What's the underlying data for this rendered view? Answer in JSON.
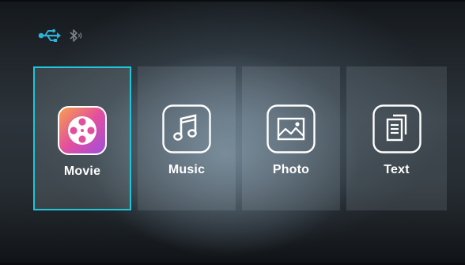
{
  "status": {
    "icons": [
      "usb-icon",
      "bluetooth-icon"
    ],
    "usb_color": "#2fb2d8"
  },
  "menu": {
    "items": [
      {
        "label": "Movie",
        "icon": "movie-icon",
        "selected": true
      },
      {
        "label": "Music",
        "icon": "music-icon",
        "selected": false
      },
      {
        "label": "Photo",
        "icon": "photo-icon",
        "selected": false
      },
      {
        "label": "Text",
        "icon": "text-icon",
        "selected": false
      }
    ]
  },
  "colors": {
    "selection": "#1ec6d8",
    "movie_icon_gradient": [
      "#f7a34a",
      "#e34f9d",
      "#9b4fe0"
    ]
  }
}
